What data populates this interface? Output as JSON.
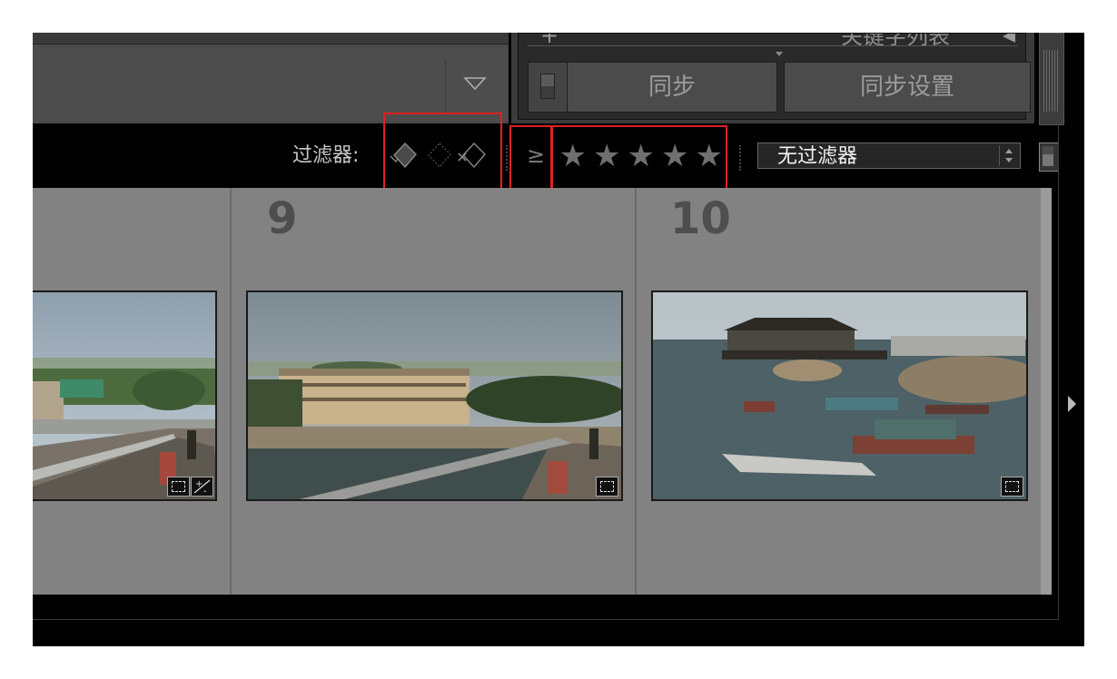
{
  "top_right": {
    "keyword_list_label": "关键字列表",
    "sync_button_label": "同步",
    "sync_settings_button_label": "同步设置"
  },
  "filter_bar": {
    "label": "过滤器:",
    "flag_icons": [
      "flagged-icon",
      "unflagged-icon",
      "rejected-icon"
    ],
    "rating_operator": "≥",
    "rating_stars": [
      "★",
      "★",
      "★",
      "★",
      "★"
    ],
    "preset_value": "无过滤器"
  },
  "grid": {
    "cells": [
      {
        "index": "",
        "photo": "waterfront-walkway"
      },
      {
        "index": "9",
        "photo": "pier-building-walkway"
      },
      {
        "index": "10",
        "photo": "harbor-pavilion-boats"
      }
    ]
  },
  "colors": {
    "highlight": "#e02020",
    "grid_background": "#828282",
    "window_background": "#000000"
  }
}
